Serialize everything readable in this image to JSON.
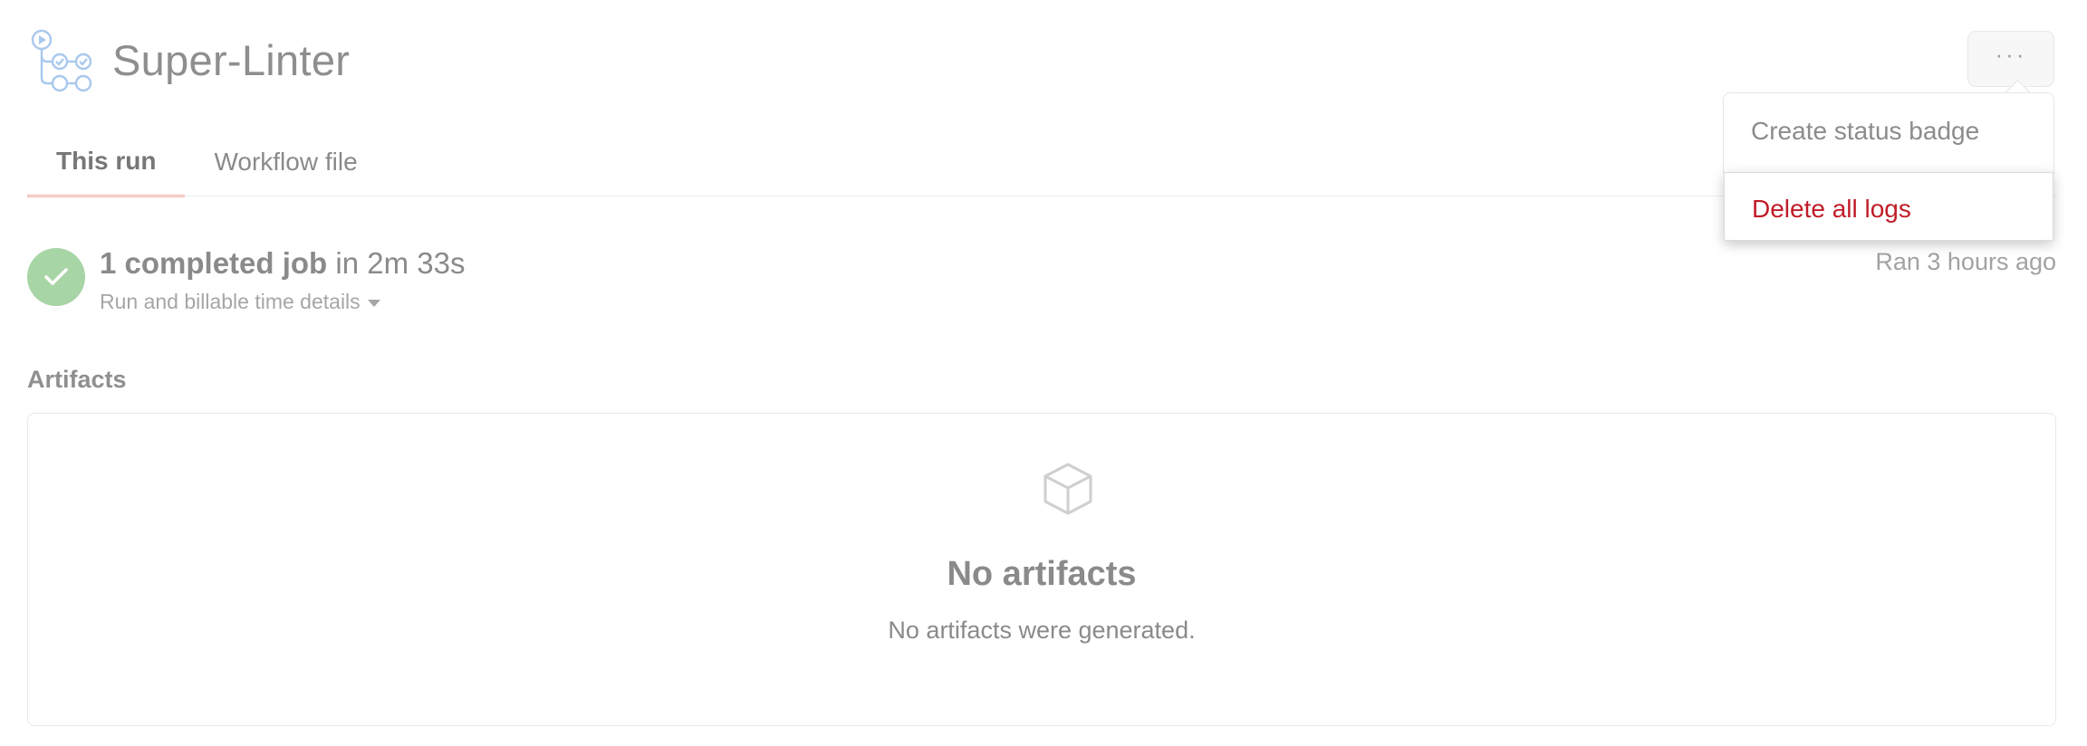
{
  "header": {
    "title": "Super-Linter",
    "workflow_icon": "workflow-icon",
    "more_button_label": "···"
  },
  "tabs": [
    {
      "label": "This run",
      "active": true
    },
    {
      "label": "Workflow file",
      "active": false
    }
  ],
  "summary": {
    "status": "success",
    "status_color": "#a8d5a6",
    "job_count_text": "1 completed job",
    "duration_text": "in 2m 33s",
    "details_toggle_label": "Run and billable time details",
    "ran_ago": "Ran 3 hours ago"
  },
  "artifacts": {
    "heading": "Artifacts",
    "empty_title": "No artifacts",
    "empty_description": "No artifacts were generated.",
    "icon": "package-icon"
  },
  "menu": {
    "items": [
      {
        "label": "Create status badge"
      },
      {
        "label": "Delete all logs",
        "danger": true,
        "color": "#c01c28"
      }
    ]
  }
}
